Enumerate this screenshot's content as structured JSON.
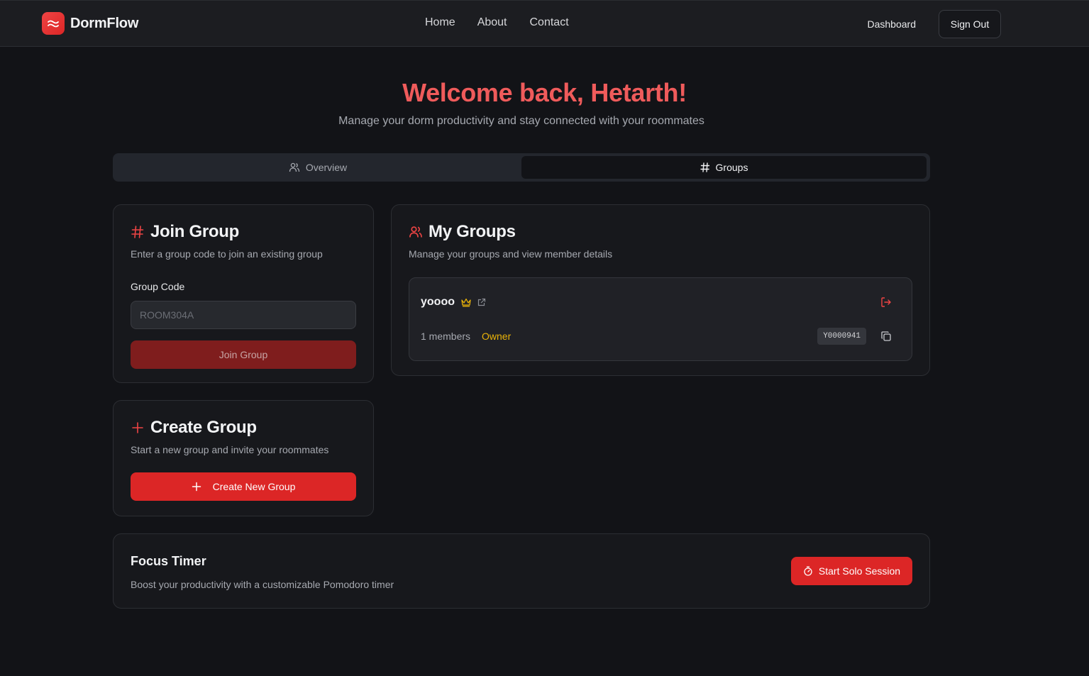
{
  "header": {
    "brand": "DormFlow",
    "nav": [
      "Home",
      "About",
      "Contact"
    ],
    "dashboard_label": "Dashboard",
    "signout_label": "Sign Out"
  },
  "hero": {
    "title": "Welcome back, Hetarth!",
    "subtitle": "Manage your dorm productivity and stay connected with your roommates"
  },
  "tabs": {
    "overview": "Overview",
    "groups": "Groups",
    "active": "Groups"
  },
  "join_group": {
    "title": "Join Group",
    "description": "Enter a group code to join an existing group",
    "field_label": "Group Code",
    "placeholder": "ROOM304A",
    "value": "",
    "button": "Join Group"
  },
  "create_group": {
    "title": "Create Group",
    "description": "Start a new group and invite your roommates",
    "button": "Create New Group"
  },
  "my_groups": {
    "title": "My Groups",
    "description": "Manage your groups and view member details",
    "groups": [
      {
        "name": "yoooo",
        "members": "1 members",
        "role": "Owner",
        "code": "Y0000941"
      }
    ]
  },
  "focus_timer": {
    "title": "Focus Timer",
    "description": "Boost your productivity with a customizable Pomodoro timer",
    "button": "Start Solo Session"
  },
  "colors": {
    "accent": "#dc2626",
    "title_red": "#ef5b5b",
    "owner_gold": "#eab308",
    "background": "#121317"
  },
  "icons": [
    "waves-icon",
    "users-icon",
    "hash-icon",
    "plus-icon",
    "crown-icon",
    "external-link-icon",
    "leave-icon",
    "copy-icon",
    "timer-icon"
  ]
}
